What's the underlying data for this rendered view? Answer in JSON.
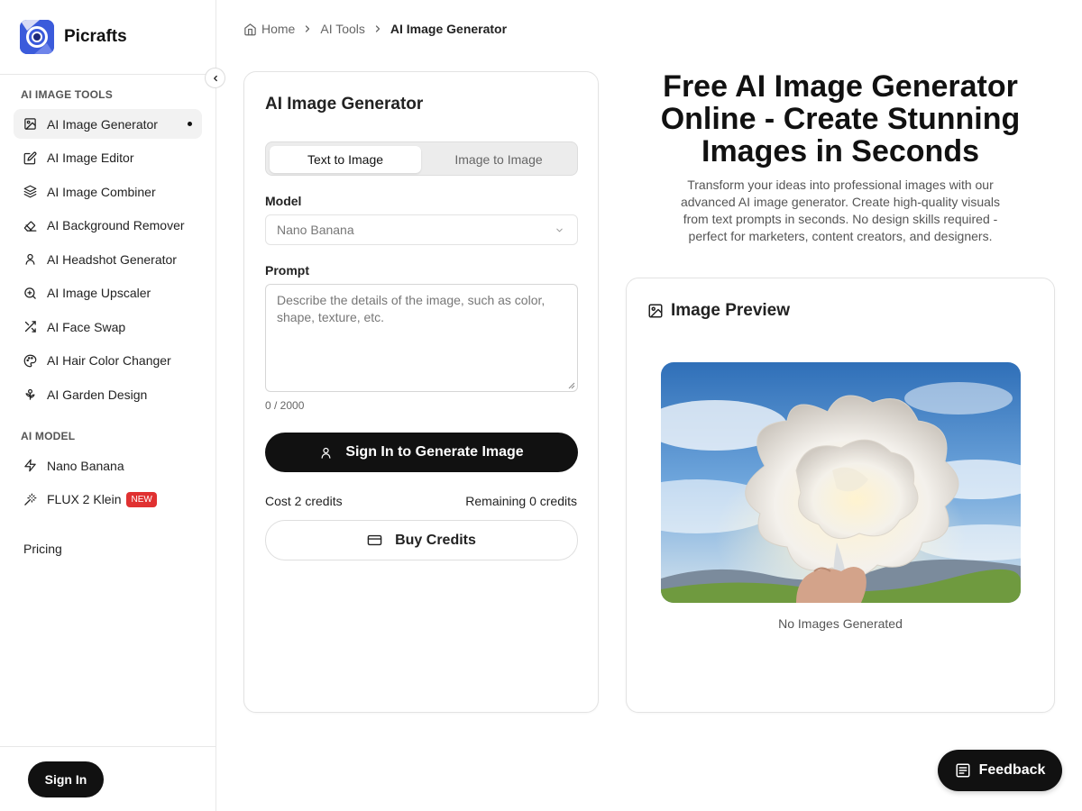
{
  "brand": {
    "name": "Picrafts"
  },
  "sidebar": {
    "tools_title": "AI IMAGE TOOLS",
    "tools": [
      {
        "label": "AI Image Generator",
        "icon": "image-icon",
        "active": true
      },
      {
        "label": "AI Image Editor",
        "icon": "edit-icon"
      },
      {
        "label": "AI Image Combiner",
        "icon": "layers-icon"
      },
      {
        "label": "AI Background Remover",
        "icon": "eraser-icon"
      },
      {
        "label": "AI Headshot Generator",
        "icon": "user-icon"
      },
      {
        "label": "AI Image Upscaler",
        "icon": "zoom-in-icon"
      },
      {
        "label": "AI Face Swap",
        "icon": "shuffle-icon"
      },
      {
        "label": "AI Hair Color Changer",
        "icon": "palette-icon"
      },
      {
        "label": "AI Garden Design",
        "icon": "flower-icon"
      }
    ],
    "model_title": "AI MODEL",
    "models": [
      {
        "label": "Nano Banana",
        "icon": "lightning-icon"
      },
      {
        "label": "FLUX 2 Klein",
        "icon": "magic-wand-icon",
        "badge": "NEW"
      }
    ],
    "pricing_label": "Pricing",
    "signin_label": "Sign In"
  },
  "breadcrumb": {
    "home": "Home",
    "parent": "AI Tools",
    "current": "AI Image Generator"
  },
  "generator": {
    "title": "AI Image Generator",
    "tab_text": "Text to Image",
    "tab_image": "Image to Image",
    "model_label": "Model",
    "model_value": "Nano Banana",
    "prompt_label": "Prompt",
    "prompt_placeholder": "Describe the details of the image, such as color, shape, texture, etc.",
    "counter": "0 / 2000",
    "generate_label": "Sign In to Generate Image",
    "cost": "Cost 2 credits",
    "remaining": "Remaining 0 credits",
    "buy_label": "Buy Credits"
  },
  "hero": {
    "title": "Free AI Image Generator Online - Create Stunning Images in Seconds",
    "subtitle": "Transform your ideas into professional images with our advanced AI image generator. Create high-quality visuals from text prompts in seconds. No design skills required - perfect for marketers, content creators, and designers."
  },
  "preview": {
    "title": "Image Preview",
    "empty_text": "No Images Generated"
  },
  "feedback": {
    "label": "Feedback"
  }
}
